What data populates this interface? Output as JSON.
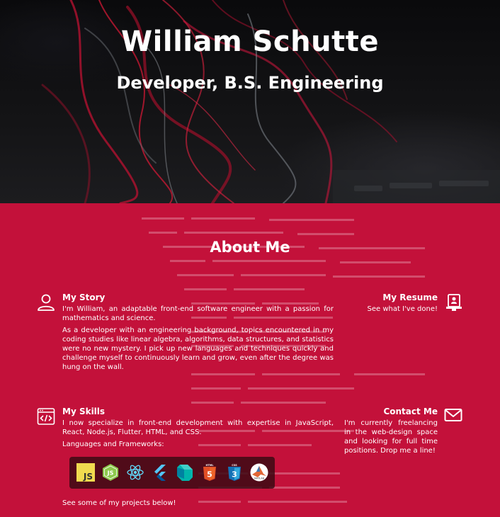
{
  "hero": {
    "name": "William Schutte",
    "subtitle": "Developer, B.S. Engineering"
  },
  "about": {
    "heading": "About Me",
    "story": {
      "title": "My Story",
      "icon": "user-icon",
      "paragraphs": [
        "I'm William, an adaptable front-end software engineer with a passion for mathematics and science.",
        "As a developer with an engineering background, topics encountered in my coding studies like linear algebra, algorithms, data structures, and statistics were no new mystery. I pick up new languages and techniques quickly and challenge myself to continuously learn and grow, even after the degree was hung on the wall."
      ]
    },
    "resume": {
      "title": "My Resume",
      "icon": "resume-icon",
      "text": "See what I've done!"
    },
    "skills": {
      "title": "My Skills",
      "icon": "code-window-icon",
      "paragraph": "I now specialize in front-end development with expertise in JavaScript, React, Node.js, Flutter, HTML, and CSS.",
      "languages_label": "Languages and Frameworks:",
      "languages": [
        "javascript-icon",
        "nodejs-icon",
        "react-icon",
        "flutter-icon",
        "dart-icon",
        "html5-icon",
        "css3-icon",
        "matlab-icon"
      ],
      "projects_text": "See some of my projects below!"
    },
    "contact": {
      "title": "Contact Me",
      "icon": "envelope-icon",
      "text": "I'm currently freelancing in the web-design space and looking for full time positions. Drop me a line!"
    }
  },
  "colors": {
    "accent": "#c3113a",
    "hero_bg": "#0a0a0c",
    "text": "#ffffff"
  }
}
